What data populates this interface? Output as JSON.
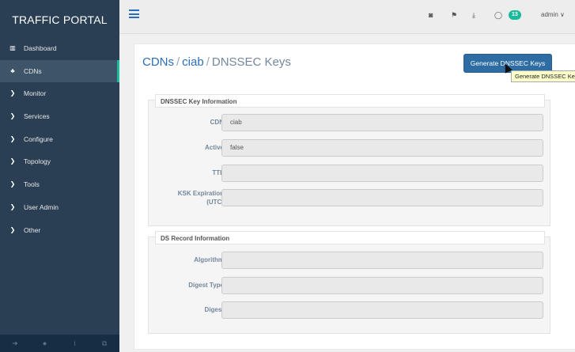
{
  "brand": "TRAFFIC PORTAL",
  "sidebar": {
    "items": [
      {
        "label": "Dashboard",
        "icon": "chart-icon"
      },
      {
        "label": "CDNs",
        "icon": "sitemap-icon"
      },
      {
        "label": "Monitor",
        "icon": "chevron-right-icon"
      },
      {
        "label": "Services",
        "icon": "chevron-right-icon"
      },
      {
        "label": "Configure",
        "icon": "chevron-right-icon"
      },
      {
        "label": "Topology",
        "icon": "chevron-right-icon"
      },
      {
        "label": "Tools",
        "icon": "chevron-right-icon"
      },
      {
        "label": "User Admin",
        "icon": "chevron-right-icon"
      },
      {
        "label": "Other",
        "icon": "chevron-right-icon"
      }
    ],
    "footer_icons": [
      "logout-icon",
      "user-icon",
      "info-icon",
      "external-link-icon"
    ]
  },
  "topbar": {
    "icons": [
      "camera-icon",
      "flag-icon",
      "download-icon",
      "comment-icon"
    ],
    "notification_count": "13",
    "user": "admin",
    "user_caret": "∨"
  },
  "breadcrumb": {
    "root": "CDNs",
    "sep": "/",
    "cdn": "ciab",
    "page": "DNSSEC Keys"
  },
  "generate_button": "Generate DNSSEC Keys",
  "tooltip": "Generate DNSSEC Keys",
  "dnssec": {
    "legend": "DNSSEC Key Information",
    "cdn_label": "CDN",
    "cdn_value": "ciab",
    "active_label": "Active",
    "active_value": "false",
    "ttl_label": "TTL",
    "ttl_value": "",
    "ksk_label_1": "KSK Expiration",
    "ksk_label_2": "(UTC)",
    "ksk_value": ""
  },
  "ds": {
    "legend": "DS Record Information",
    "algorithm_label": "Algorithm",
    "algorithm_value": "",
    "digest_type_label": "Digest Type",
    "digest_type_value": "",
    "digest_label": "Digest",
    "digest_value": ""
  },
  "colors": {
    "sidebar": "#2a3f54",
    "accent": "#1abb9c",
    "button": "#2e6da4"
  }
}
